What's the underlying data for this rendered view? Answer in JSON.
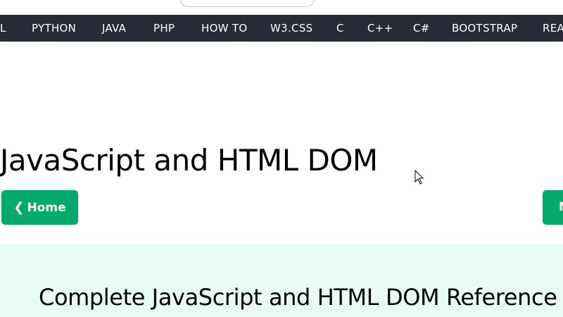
{
  "nav": {
    "items": [
      "L",
      "PYTHON",
      "JAVA",
      "PHP",
      "HOW TO",
      "W3.CSS",
      "C",
      "C++",
      "C#",
      "BOOTSTRAP",
      "REA"
    ]
  },
  "main": {
    "title": "JavaScript and HTML DOM",
    "home_button": "Home",
    "next_button": "N"
  },
  "reference": {
    "heading": "Complete JavaScript and HTML DOM Reference"
  },
  "colors": {
    "nav_bg": "#282a35",
    "accent": "#04aa6d",
    "section_bg": "#e7fbf2"
  }
}
